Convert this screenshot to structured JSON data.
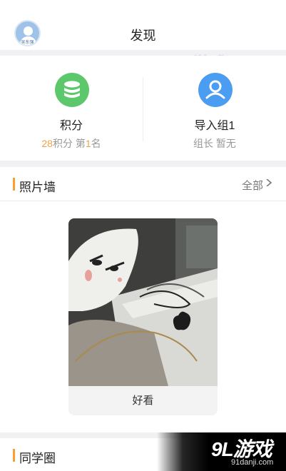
{
  "header": {
    "title": "发现",
    "avatar_name": "吴东强"
  },
  "watermark": {
    "brand": "9L游戏",
    "url": "91danji.com"
  },
  "stats": {
    "points": {
      "label": "积分",
      "count": "28",
      "count_unit": "积分 第",
      "rank": "1",
      "rank_unit": "名",
      "icon": "coin-stack-icon"
    },
    "group": {
      "label": "导入组1",
      "sub": "组长 暂无",
      "icon": "group-icon"
    }
  },
  "photo_wall": {
    "title": "照片墙",
    "more_label": "全部",
    "items": [
      {
        "caption": "好看"
      }
    ]
  },
  "classmates": {
    "title": "同学圈"
  },
  "colors": {
    "accent": "#f5a033",
    "green": "#5cc86b",
    "blue": "#4a9df0"
  }
}
